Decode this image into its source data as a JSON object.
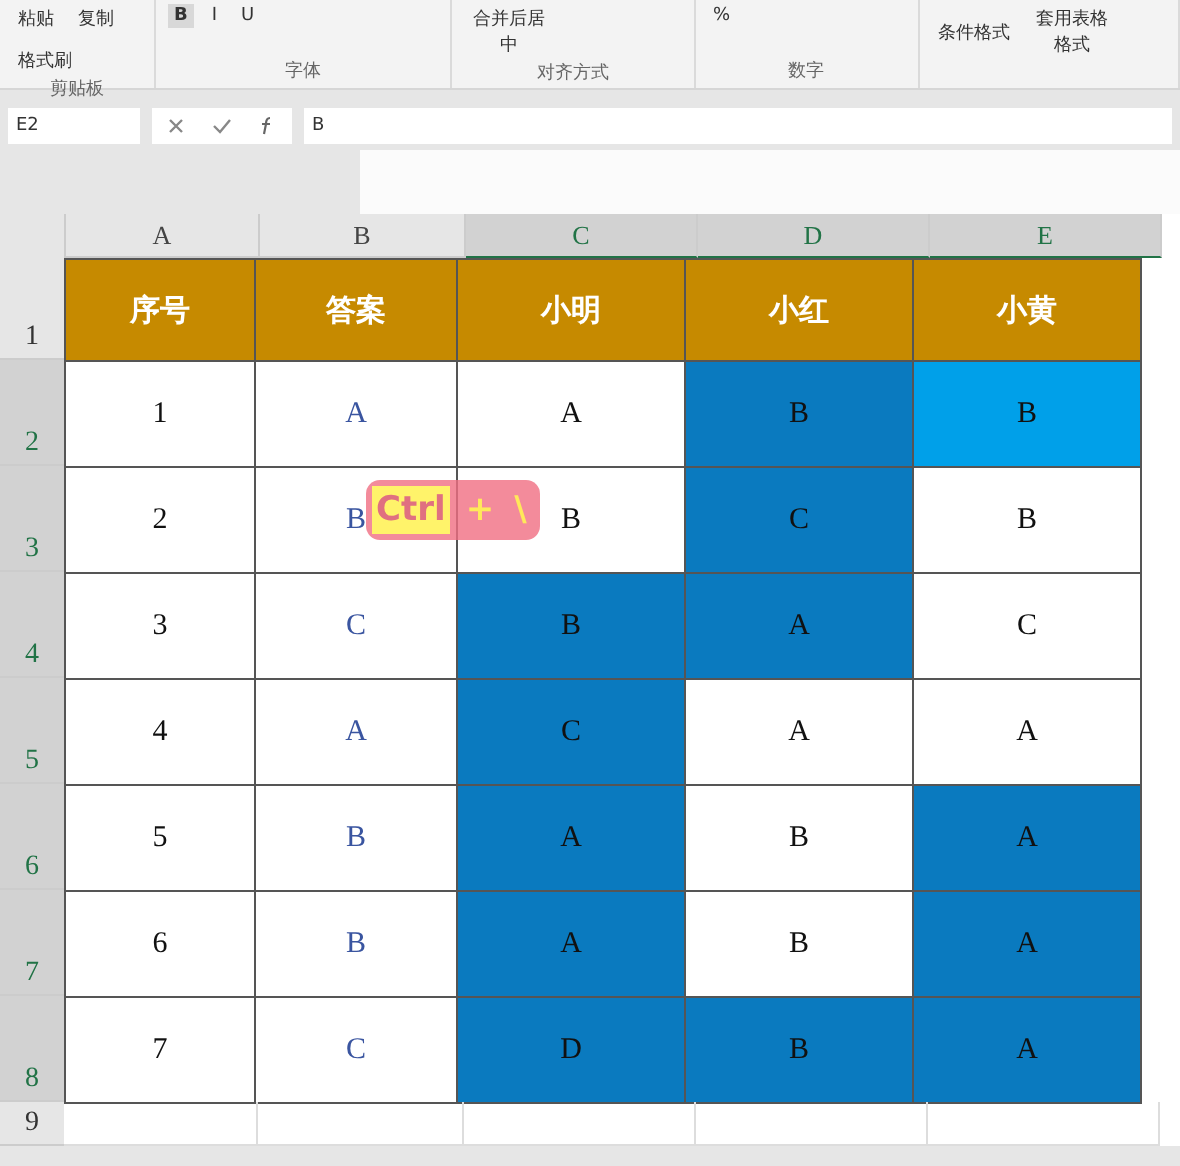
{
  "ribbon": {
    "groups": [
      {
        "kind": "clipboard",
        "label": "剪贴板",
        "items": [
          "粘贴",
          "复制",
          "格式刷"
        ]
      },
      {
        "kind": "font",
        "label": "字体",
        "items": [
          "B",
          "I",
          "U"
        ]
      },
      {
        "kind": "align",
        "label": "对齐方式",
        "items": [
          "合并后居中"
        ]
      },
      {
        "kind": "number",
        "label": "数字",
        "items": [
          "%"
        ]
      },
      {
        "kind": "styles",
        "items": [
          "条件格式",
          "套用表格格式"
        ]
      }
    ]
  },
  "formula_bar": {
    "name_box": "E2",
    "value": "B"
  },
  "sheet": {
    "columns": [
      {
        "label": "A",
        "selected": false
      },
      {
        "label": "B",
        "selected": false
      },
      {
        "label": "C",
        "selected": true
      },
      {
        "label": "D",
        "selected": true
      },
      {
        "label": "E",
        "selected": true
      }
    ],
    "header_row": {
      "row_label": "1",
      "selected": false,
      "cells": [
        "序号",
        "答案",
        "小明",
        "小红",
        "小黄"
      ]
    },
    "rows": [
      {
        "row_label": "2",
        "selected": true,
        "number": "1",
        "answer": "A",
        "cells": [
          {
            "value": "A",
            "highlighted": false,
            "active": false
          },
          {
            "value": "B",
            "highlighted": true,
            "active": false
          },
          {
            "value": "B",
            "highlighted": true,
            "active": true
          }
        ]
      },
      {
        "row_label": "3",
        "selected": true,
        "number": "2",
        "answer": "B",
        "cells": [
          {
            "value": "B",
            "highlighted": false,
            "active": false
          },
          {
            "value": "C",
            "highlighted": true,
            "active": false
          },
          {
            "value": "B",
            "highlighted": false,
            "active": false
          }
        ]
      },
      {
        "row_label": "4",
        "selected": true,
        "number": "3",
        "answer": "C",
        "cells": [
          {
            "value": "B",
            "highlighted": true,
            "active": false
          },
          {
            "value": "A",
            "highlighted": true,
            "active": false
          },
          {
            "value": "C",
            "highlighted": false,
            "active": false
          }
        ]
      },
      {
        "row_label": "5",
        "selected": true,
        "number": "4",
        "answer": "A",
        "cells": [
          {
            "value": "C",
            "highlighted": true,
            "active": false
          },
          {
            "value": "A",
            "highlighted": false,
            "active": false
          },
          {
            "value": "A",
            "highlighted": false,
            "active": false
          }
        ]
      },
      {
        "row_label": "6",
        "selected": true,
        "number": "5",
        "answer": "B",
        "cells": [
          {
            "value": "A",
            "highlighted": true,
            "active": false
          },
          {
            "value": "B",
            "highlighted": false,
            "active": false
          },
          {
            "value": "A",
            "highlighted": true,
            "active": false
          }
        ]
      },
      {
        "row_label": "7",
        "selected": true,
        "number": "6",
        "answer": "B",
        "cells": [
          {
            "value": "A",
            "highlighted": true,
            "active": false
          },
          {
            "value": "B",
            "highlighted": false,
            "active": false
          },
          {
            "value": "A",
            "highlighted": true,
            "active": false
          }
        ]
      },
      {
        "row_label": "8",
        "selected": true,
        "number": "7",
        "answer": "C",
        "cells": [
          {
            "value": "D",
            "highlighted": true,
            "active": false
          },
          {
            "value": "B",
            "highlighted": true,
            "active": false
          },
          {
            "value": "A",
            "highlighted": true,
            "active": false
          }
        ]
      }
    ],
    "empty_rows": [
      {
        "row_label": "9",
        "selected": false
      }
    ]
  },
  "keystroke_overlay": {
    "keys": [
      "Ctrl",
      "+",
      "\\"
    ]
  }
}
